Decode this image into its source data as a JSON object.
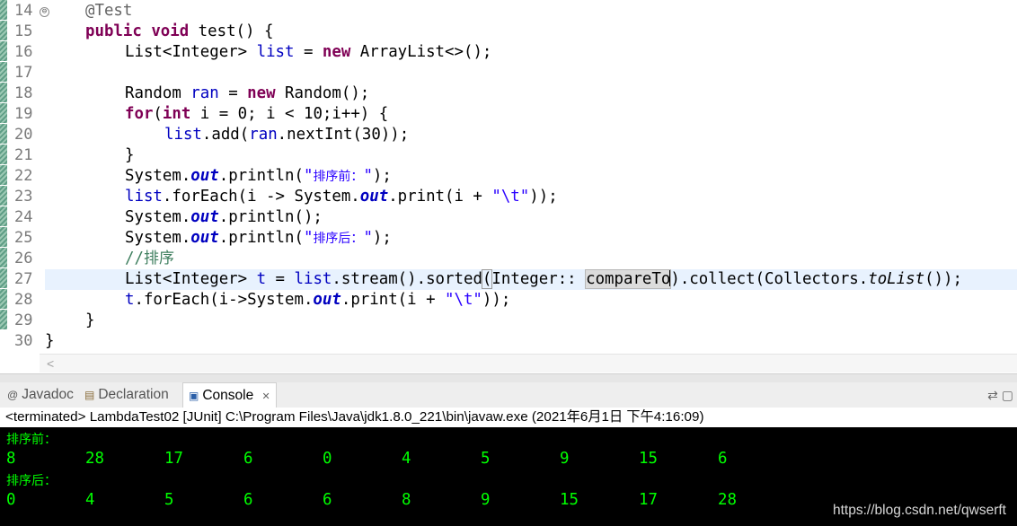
{
  "editor": {
    "line_numbers": [
      "14",
      "15",
      "16",
      "17",
      "18",
      "19",
      "20",
      "21",
      "22",
      "23",
      "24",
      "25",
      "26",
      "27",
      "28",
      "29",
      "30"
    ],
    "fold_marker": "⊖",
    "code": {
      "l14_annotation": "@Test",
      "l15_kw1": "public",
      "l15_kw2": "void",
      "l15_rest": " test() {",
      "l16_pre": "List<Integer> ",
      "l16_var": "list",
      "l16_mid": " = ",
      "l16_kw": "new",
      "l16_post": " ArrayList<>();",
      "l18_pre": "Random ",
      "l18_var": "ran",
      "l18_mid": " = ",
      "l18_kw": "new",
      "l18_post": " Random();",
      "l19_kw1": "for",
      "l19_a": "(",
      "l19_kw2": "int",
      "l19_b": " i = 0; i < 10;i++) {",
      "l20_var1": "list",
      "l20_a": ".add(",
      "l20_var2": "ran",
      "l20_b": ".nextInt(30));",
      "l21": "}",
      "l22_a": "System.",
      "l22_out": "out",
      "l22_b": ".println(",
      "l22_q1": "\"",
      "l22_cjk": "排序前：",
      "l22_q2": "\"",
      "l22_c": ");",
      "l23_var": "list",
      "l23_a": ".forEach(i -> System.",
      "l23_out": "out",
      "l23_b": ".print(i + ",
      "l23_str": "\"\\t\"",
      "l23_c": "));",
      "l24_a": "System.",
      "l24_out": "out",
      "l24_b": ".println();",
      "l25_a": "System.",
      "l25_out": "out",
      "l25_b": ".println(",
      "l25_q1": "\"",
      "l25_cjk": "排序后：",
      "l25_q2": "\"",
      "l25_c": ");",
      "l26_slashes": "//",
      "l26_cjk": "排序",
      "l27_a": "List<Integer> ",
      "l27_var1": "t",
      "l27_b": " = ",
      "l27_var2": "list",
      "l27_c": ".stream().sorted",
      "l27_p1": "(",
      "l27_d": "Integer:: ",
      "l27_sel": "compareTo",
      "l27_p2": ")",
      "l27_e": ".collect(Collectors.",
      "l27_static": "toList",
      "l27_f": "());",
      "l28_var": "t",
      "l28_a": ".forEach(i->System.",
      "l28_out": "out",
      "l28_b": ".print(i + ",
      "l28_str": "\"\\t\"",
      "l28_c": "));",
      "l29": "}",
      "l30": "}"
    },
    "scroll_left_glyph": "<"
  },
  "tabs": [
    {
      "icon": "@",
      "label": "Javadoc"
    },
    {
      "icon": "▤",
      "label": "Declaration"
    },
    {
      "icon": "▣",
      "label": "Console",
      "close": "✕"
    }
  ],
  "tabbar_right_icons": "⇄  ▢",
  "console": {
    "terminated_line": "<terminated> LambdaTest02 [JUnit] C:\\Program Files\\Java\\jdk1.8.0_221\\bin\\javaw.exe (2021年6月1日 下午4:16:09)",
    "before_label": "排序前：",
    "before_values": [
      "8",
      "28",
      "17",
      "6",
      "0",
      "4",
      "5",
      "9",
      "15",
      "6"
    ],
    "after_label": "排序后：",
    "after_values": [
      "0",
      "4",
      "5",
      "6",
      "6",
      "8",
      "9",
      "15",
      "17",
      "28"
    ],
    "watermark": "https://blog.csdn.net/qwserft"
  },
  "colors": {
    "keyword": "#7f0055",
    "field": "#0000c0",
    "string": "#2a00ff",
    "comment": "#3f7f5f",
    "console_fg": "#00ff00",
    "console_bg": "#000000",
    "current_line": "#e8f2fe"
  }
}
